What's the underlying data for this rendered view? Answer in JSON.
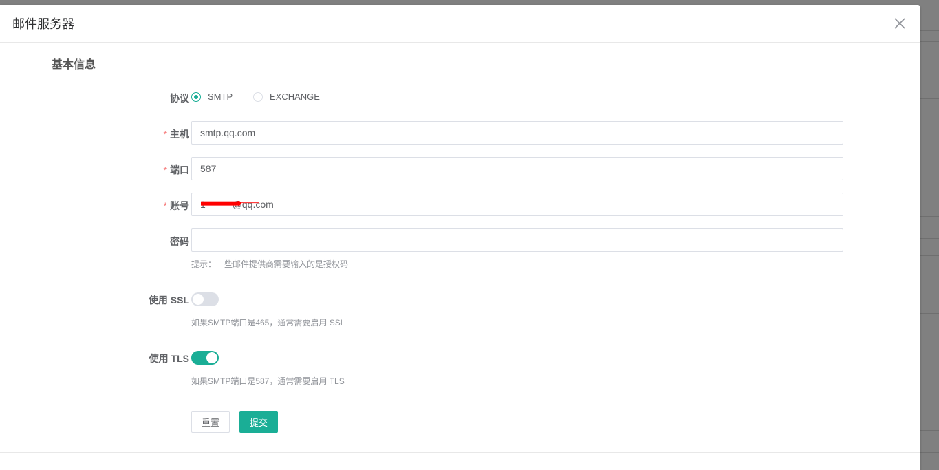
{
  "dialog": {
    "title": "邮件服务器"
  },
  "section": {
    "title": "基本信息"
  },
  "form": {
    "protocol": {
      "label": "协议",
      "options": [
        "SMTP",
        "EXCHANGE"
      ],
      "selected": "SMTP"
    },
    "host": {
      "label": "主机",
      "required_mark": "*",
      "value": "smtp.qq.com"
    },
    "port": {
      "label": "端口",
      "required_mark": "*",
      "value": "587"
    },
    "account": {
      "label": "账号",
      "required_mark": "*",
      "value": "1          @qq.com"
    },
    "password": {
      "label": "密码",
      "value": "",
      "hint": "提示：一些邮件提供商需要输入的是授权码"
    },
    "ssl": {
      "label": "使用 SSL",
      "enabled": false,
      "hint": "如果SMTP端口是465，通常需要启用 SSL"
    },
    "tls": {
      "label": "使用 TLS",
      "enabled": true,
      "hint": "如果SMTP端口是587，通常需要启用 TLS"
    },
    "buttons": {
      "reset": "重置",
      "submit": "提交"
    }
  },
  "colors": {
    "primary": "#1aae96",
    "required": "#f56c6c",
    "redaction": "#ff0000"
  }
}
